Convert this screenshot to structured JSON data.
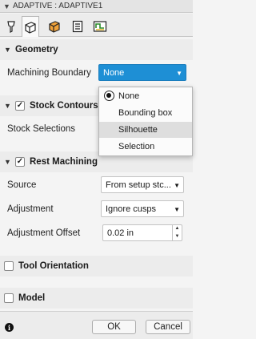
{
  "window": {
    "title": "ADAPTIVE : ADAPTIVE1"
  },
  "tabs": [
    {
      "name": "tool-tab-icon",
      "active": false
    },
    {
      "name": "geometry-tab-icon",
      "active": true
    },
    {
      "name": "heights-tab-icon",
      "active": false
    },
    {
      "name": "passes-tab-icon",
      "active": false
    },
    {
      "name": "linking-tab-icon",
      "active": false
    }
  ],
  "geometry": {
    "header": "Geometry",
    "machining_boundary_label": "Machining Boundary",
    "machining_boundary_value": "None",
    "dropdown_options": [
      "None",
      "Bounding box",
      "Silhouette",
      "Selection"
    ],
    "selected_option": "None",
    "hovered_option": "Silhouette"
  },
  "stock_contours": {
    "header": "Stock Contours",
    "checked": true,
    "stock_selections_label": "Stock Selections"
  },
  "rest_machining": {
    "header": "Rest Machining",
    "checked": true,
    "source_label": "Source",
    "source_value": "From setup stc...",
    "adjustment_label": "Adjustment",
    "adjustment_value": "Ignore cusps",
    "adjustment_offset_label": "Adjustment Offset",
    "adjustment_offset_value": "0.02 in"
  },
  "tool_orientation": {
    "header": "Tool Orientation",
    "checked": false
  },
  "model": {
    "header": "Model",
    "checked": false
  },
  "footer": {
    "ok_label": "OK",
    "cancel_label": "Cancel"
  }
}
